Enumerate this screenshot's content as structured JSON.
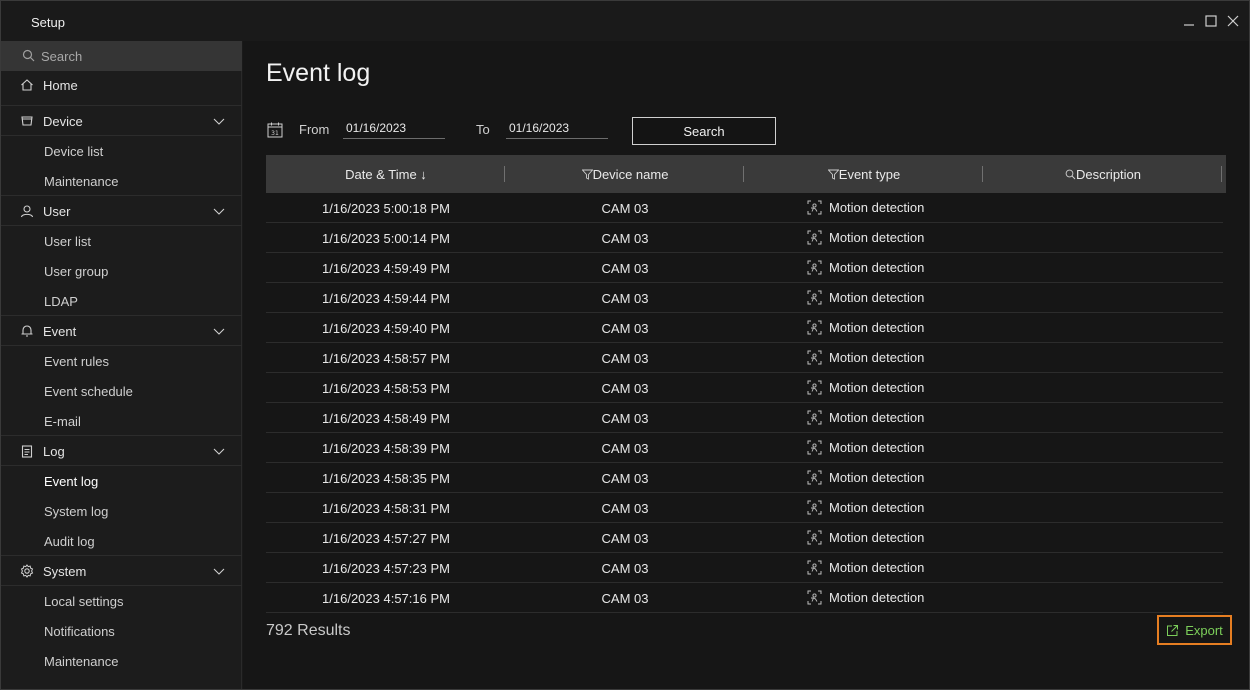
{
  "window": {
    "title": "Setup"
  },
  "sidebar": {
    "search_placeholder": "Search",
    "home": "Home",
    "groups": [
      {
        "label": "Device",
        "icon": "device-icon",
        "items": [
          "Device list",
          "Maintenance"
        ]
      },
      {
        "label": "User",
        "icon": "user-icon",
        "items": [
          "User list",
          "User group",
          "LDAP"
        ]
      },
      {
        "label": "Event",
        "icon": "bell-icon",
        "items": [
          "Event rules",
          "Event schedule",
          "E-mail"
        ]
      },
      {
        "label": "Log",
        "icon": "clipboard-icon",
        "items": [
          "Event log",
          "System log",
          "Audit log"
        ]
      },
      {
        "label": "System",
        "icon": "gear-icon",
        "items": [
          "Local settings",
          "Notifications",
          "Maintenance"
        ]
      }
    ],
    "active_item": "Event log"
  },
  "main": {
    "title": "Event log",
    "filter": {
      "from_label": "From",
      "from_value": "01/16/2023",
      "to_label": "To",
      "to_value": "01/16/2023",
      "search_label": "Search"
    },
    "columns": [
      "Date & Time ↓",
      "Device name",
      "Event type",
      "Description"
    ],
    "rows": [
      {
        "datetime": "1/16/2023 5:00:18 PM",
        "device": "CAM 03",
        "event": "Motion detection",
        "description": ""
      },
      {
        "datetime": "1/16/2023 5:00:14 PM",
        "device": "CAM 03",
        "event": "Motion detection",
        "description": ""
      },
      {
        "datetime": "1/16/2023 4:59:49 PM",
        "device": "CAM 03",
        "event": "Motion detection",
        "description": ""
      },
      {
        "datetime": "1/16/2023 4:59:44 PM",
        "device": "CAM 03",
        "event": "Motion detection",
        "description": ""
      },
      {
        "datetime": "1/16/2023 4:59:40 PM",
        "device": "CAM 03",
        "event": "Motion detection",
        "description": ""
      },
      {
        "datetime": "1/16/2023 4:58:57 PM",
        "device": "CAM 03",
        "event": "Motion detection",
        "description": ""
      },
      {
        "datetime": "1/16/2023 4:58:53 PM",
        "device": "CAM 03",
        "event": "Motion detection",
        "description": ""
      },
      {
        "datetime": "1/16/2023 4:58:49 PM",
        "device": "CAM 03",
        "event": "Motion detection",
        "description": ""
      },
      {
        "datetime": "1/16/2023 4:58:39 PM",
        "device": "CAM 03",
        "event": "Motion detection",
        "description": ""
      },
      {
        "datetime": "1/16/2023 4:58:35 PM",
        "device": "CAM 03",
        "event": "Motion detection",
        "description": ""
      },
      {
        "datetime": "1/16/2023 4:58:31 PM",
        "device": "CAM 03",
        "event": "Motion detection",
        "description": ""
      },
      {
        "datetime": "1/16/2023 4:57:27 PM",
        "device": "CAM 03",
        "event": "Motion detection",
        "description": ""
      },
      {
        "datetime": "1/16/2023 4:57:23 PM",
        "device": "CAM 03",
        "event": "Motion detection",
        "description": ""
      },
      {
        "datetime": "1/16/2023 4:57:16 PM",
        "device": "CAM 03",
        "event": "Motion detection",
        "description": ""
      }
    ],
    "results_text": "792 Results",
    "export_label": "Export"
  },
  "colors": {
    "accent_border": "#e67e22",
    "export_text": "#7ccf5a",
    "background": "#161616",
    "header": "#3a3a3a"
  }
}
